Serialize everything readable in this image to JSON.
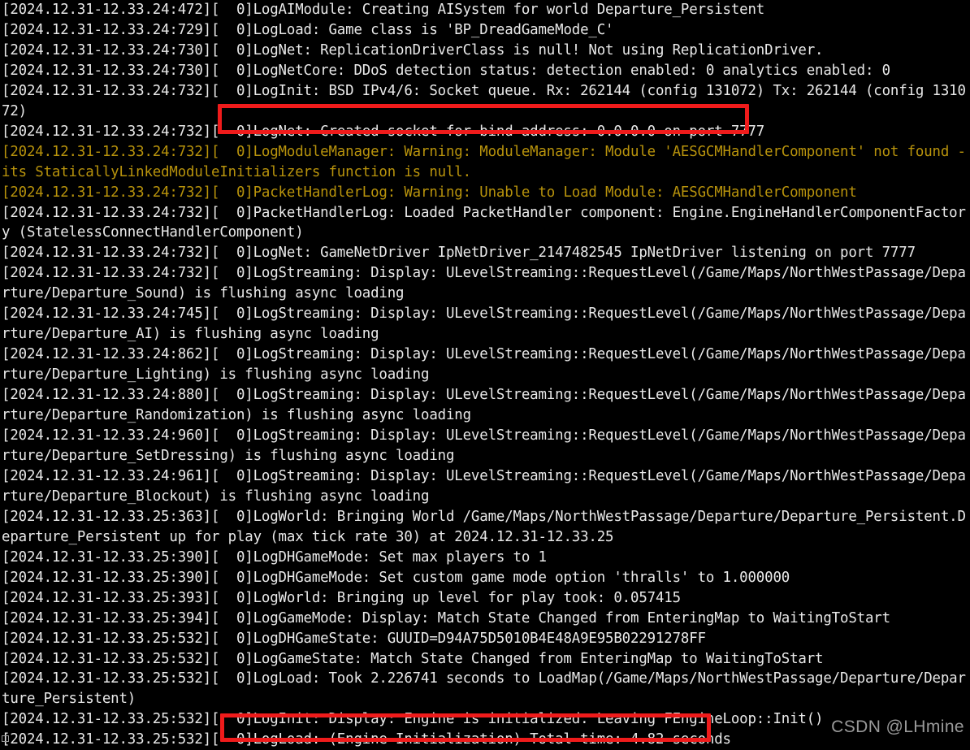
{
  "window": {
    "type": "console-log-viewer",
    "background_color": "#000000",
    "text_color": "#e8e8e8",
    "warning_color": "#b8930c",
    "highlight_color": "#ef1b1b"
  },
  "log": {
    "lines": [
      {
        "id": "line-1",
        "level": "normal",
        "text": "[2024.12.31-12.33.24:472][  0]LogAIModule: Creating AISystem for world Departure_Persistent"
      },
      {
        "id": "line-2",
        "level": "normal",
        "text": "[2024.12.31-12.33.24:729][  0]LogLoad: Game class is 'BP_DreadGameMode_C'"
      },
      {
        "id": "line-3",
        "level": "normal",
        "text": "[2024.12.31-12.33.24:730][  0]LogNet: ReplicationDriverClass is null! Not using ReplicationDriver."
      },
      {
        "id": "line-4",
        "level": "normal",
        "text": "[2024.12.31-12.33.24:730][  0]LogNetCore: DDoS detection status: detection enabled: 0 analytics enabled: 0"
      },
      {
        "id": "line-5",
        "level": "normal",
        "text": "[2024.12.31-12.33.24:732][  0]LogInit: BSD IPv4/6: Socket queue. Rx: 262144 (config 131072) Tx: 262144 (config 131072)"
      },
      {
        "id": "line-6",
        "level": "normal",
        "highlighted": true,
        "text": "[2024.12.31-12.33.24:732][  0]LogNet: Created socket for bind address: 0.0.0.0 on port 7777"
      },
      {
        "id": "line-7",
        "level": "warning",
        "text": "[2024.12.31-12.33.24:732][  0]LogModuleManager: Warning: ModuleManager: Module 'AESGCMHandlerComponent' not found - its StaticallyLinkedModuleInitializers function is null."
      },
      {
        "id": "line-8",
        "level": "warning",
        "text": "[2024.12.31-12.33.24:732][  0]PacketHandlerLog: Warning: Unable to Load Module: AESGCMHandlerComponent"
      },
      {
        "id": "line-9",
        "level": "normal",
        "text": "[2024.12.31-12.33.24:732][  0]PacketHandlerLog: Loaded PacketHandler component: Engine.EngineHandlerComponentFactory (StatelessConnectHandlerComponent)"
      },
      {
        "id": "line-10",
        "level": "normal",
        "text": "[2024.12.31-12.33.24:732][  0]LogNet: GameNetDriver IpNetDriver_2147482545 IpNetDriver listening on port 7777"
      },
      {
        "id": "line-11",
        "level": "normal",
        "text": "[2024.12.31-12.33.24:732][  0]LogStreaming: Display: ULevelStreaming::RequestLevel(/Game/Maps/NorthWestPassage/Departure/Departure_Sound) is flushing async loading"
      },
      {
        "id": "line-12",
        "level": "normal",
        "text": "[2024.12.31-12.33.24:745][  0]LogStreaming: Display: ULevelStreaming::RequestLevel(/Game/Maps/NorthWestPassage/Departure/Departure_AI) is flushing async loading"
      },
      {
        "id": "line-13",
        "level": "normal",
        "text": "[2024.12.31-12.33.24:862][  0]LogStreaming: Display: ULevelStreaming::RequestLevel(/Game/Maps/NorthWestPassage/Departure/Departure_Lighting) is flushing async loading"
      },
      {
        "id": "line-14",
        "level": "normal",
        "text": "[2024.12.31-12.33.24:880][  0]LogStreaming: Display: ULevelStreaming::RequestLevel(/Game/Maps/NorthWestPassage/Departure/Departure_Randomization) is flushing async loading"
      },
      {
        "id": "line-15",
        "level": "normal",
        "text": "[2024.12.31-12.33.24:960][  0]LogStreaming: Display: ULevelStreaming::RequestLevel(/Game/Maps/NorthWestPassage/Departure/Departure_SetDressing) is flushing async loading"
      },
      {
        "id": "line-16",
        "level": "normal",
        "text": "[2024.12.31-12.33.24:961][  0]LogStreaming: Display: ULevelStreaming::RequestLevel(/Game/Maps/NorthWestPassage/Departure/Departure_Blockout) is flushing async loading"
      },
      {
        "id": "line-17",
        "level": "normal",
        "text": "[2024.12.31-12.33.25:363][  0]LogWorld: Bringing World /Game/Maps/NorthWestPassage/Departure/Departure_Persistent.Departure_Persistent up for play (max tick rate 30) at 2024.12.31-12.33.25"
      },
      {
        "id": "line-18",
        "level": "normal",
        "text": "[2024.12.31-12.33.25:390][  0]LogDHGameMode: Set max players to 1"
      },
      {
        "id": "line-19",
        "level": "normal",
        "text": "[2024.12.31-12.33.25:390][  0]LogDHGameMode: Set custom game mode option 'thralls' to 1.000000"
      },
      {
        "id": "line-20",
        "level": "normal",
        "text": "[2024.12.31-12.33.25:393][  0]LogWorld: Bringing up level for play took: 0.057415"
      },
      {
        "id": "line-21",
        "level": "normal",
        "text": "[2024.12.31-12.33.25:394][  0]LogGameMode: Display: Match State Changed from EnteringMap to WaitingToStart"
      },
      {
        "id": "line-22",
        "level": "normal",
        "text": "[2024.12.31-12.33.25:532][  0]LogDHGameState: GUUID=D94A75D5010B4E48A9E95B02291278FF"
      },
      {
        "id": "line-23",
        "level": "normal",
        "text": "[2024.12.31-12.33.25:532][  0]LogGameState: Match State Changed from EnteringMap to WaitingToStart"
      },
      {
        "id": "line-24",
        "level": "normal",
        "text": "[2024.12.31-12.33.25:532][  0]LogLoad: Took 2.226741 seconds to LoadMap(/Game/Maps/NorthWestPassage/Departure/Departure_Persistent)"
      },
      {
        "id": "line-25",
        "level": "normal",
        "text": "[2024.12.31-12.33.25:532][  0]LogInit: Display: Engine is initialized. Leaving FEngineLoop::Init()"
      },
      {
        "id": "line-26",
        "level": "normal",
        "highlighted": true,
        "text": "[2024.12.31-12.33.25:532][  0]LogLoad: (Engine Initialization) Total time: 4.82 seconds"
      }
    ]
  },
  "annotations": {
    "highlight_boxes": [
      {
        "id": "hl-socket",
        "target_line": "line-6",
        "label": "LogNet: Created socket for bind address: 0.0.0.0 on port 7777"
      },
      {
        "id": "hl-total-time",
        "target_line": "line-26",
        "label": "LogLoad: (Engine Initialization) Total time: 4.82 seconds"
      }
    ]
  },
  "watermark": {
    "text": "CSDN @LHmine"
  }
}
